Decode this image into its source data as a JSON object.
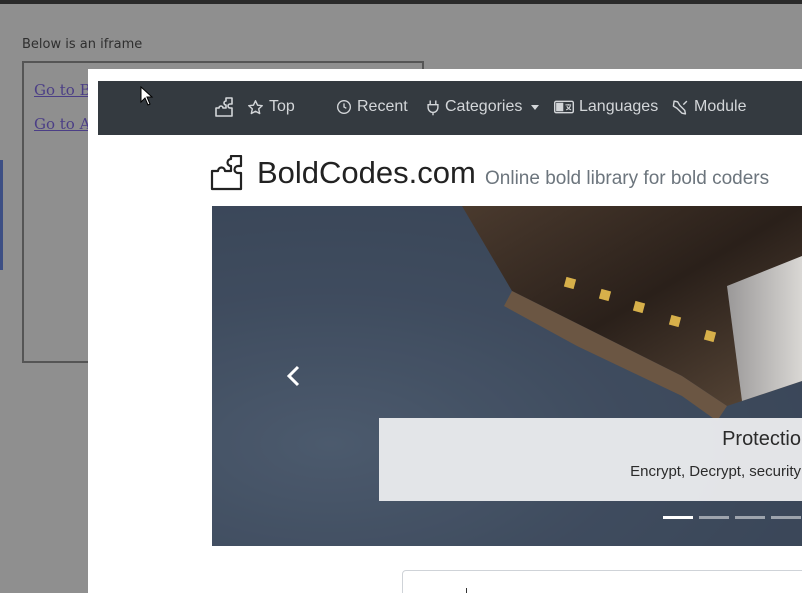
{
  "background_page": {
    "caption": "Below is an iframe",
    "links": [
      "Go to Bo",
      "Go to AN"
    ]
  },
  "navbar": {
    "brand_icon": "puzzle-icon",
    "items": [
      {
        "label": "Top",
        "icon": "star-icon"
      },
      {
        "label": "Recent",
        "icon": "clock-icon"
      },
      {
        "label": "Categories",
        "icon": "plug-icon",
        "dropdown": true
      },
      {
        "label": "Languages",
        "icon": "language-icon"
      },
      {
        "label": "Module",
        "icon": "plugin-icon"
      }
    ]
  },
  "header": {
    "site_name": "BoldCodes.com",
    "tagline": "Online bold library for bold coders"
  },
  "carousel": {
    "caption_title": "Protectio",
    "caption_text": "Encrypt, Decrypt, security",
    "slide_count": 4,
    "active_slide": 1
  },
  "colors": {
    "navbar_bg": "#343a40",
    "navbar_text": "#d3d6d9",
    "link": "#4b3e86",
    "tagline": "#6c757d"
  }
}
